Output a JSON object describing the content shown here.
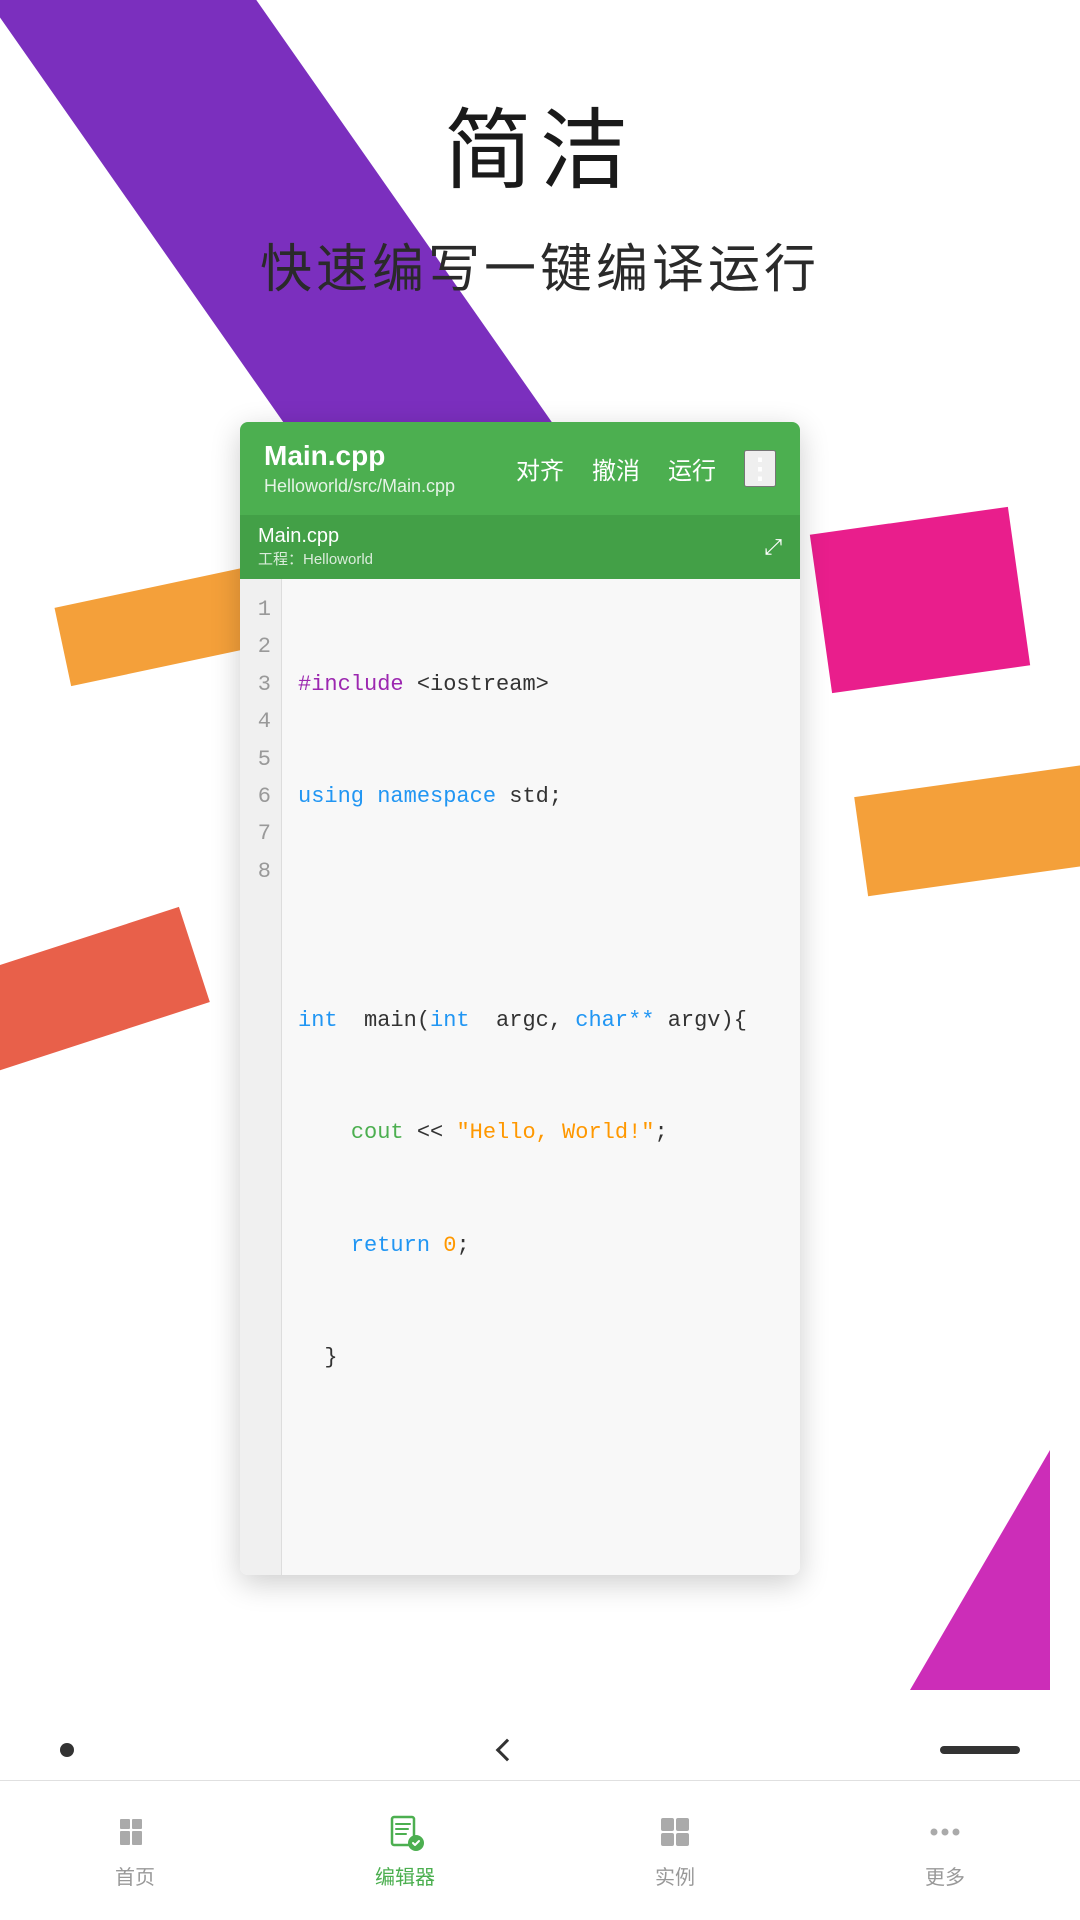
{
  "page": {
    "title": "简洁",
    "subtitle": "快速编写一键编译运行"
  },
  "editor": {
    "file_name": "Main.cpp",
    "file_path": "Helloworld/src/Main.cpp",
    "tab_filename": "Main.cpp",
    "tab_project": "工程：Helloworld",
    "toolbar_align": "对齐",
    "toolbar_undo": "撤消",
    "toolbar_run": "运行",
    "toolbar_more": "⋮"
  },
  "code": {
    "lines": [
      {
        "num": "1",
        "content": "#include <iostream>"
      },
      {
        "num": "2",
        "content": "using namespace std;"
      },
      {
        "num": "3",
        "content": ""
      },
      {
        "num": "4",
        "content": "int  main(int  argc, char** argv){"
      },
      {
        "num": "5",
        "content": "    cout << \"Hello, World!\";"
      },
      {
        "num": "6",
        "content": "    return 0;"
      },
      {
        "num": "7",
        "content": "  }"
      },
      {
        "num": "8",
        "content": ""
      }
    ]
  },
  "bottom_nav": {
    "items": [
      {
        "label": "首页",
        "icon": "home",
        "active": false
      },
      {
        "label": "编辑器",
        "icon": "editor",
        "active": true
      },
      {
        "label": "实例",
        "icon": "examples",
        "active": false
      },
      {
        "label": "更多",
        "icon": "more",
        "active": false
      }
    ]
  }
}
